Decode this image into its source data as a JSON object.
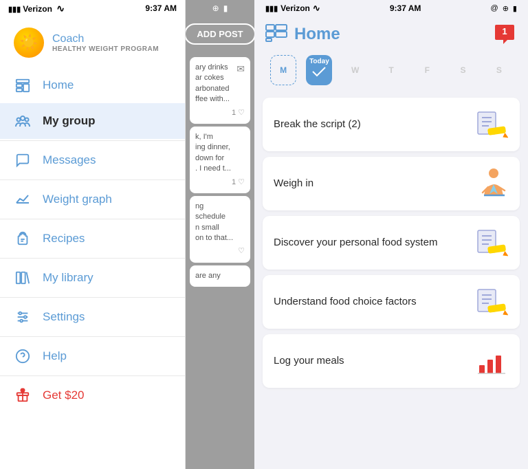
{
  "leftPanel": {
    "statusBar": {
      "carrier": "Verizon",
      "wifi": "wifi",
      "time": "9:37 AM"
    },
    "coach": {
      "label": "Coach",
      "subtitle": "HEALTHY WEIGHT PROGRAM"
    },
    "navItems": [
      {
        "id": "home",
        "label": "Home",
        "icon": "home-icon"
      },
      {
        "id": "my-group",
        "label": "My group",
        "icon": "group-icon",
        "active": true
      },
      {
        "id": "messages",
        "label": "Messages",
        "icon": "message-icon"
      },
      {
        "id": "weight-graph",
        "label": "Weight graph",
        "icon": "graph-icon"
      },
      {
        "id": "recipes",
        "label": "Recipes",
        "icon": "recipes-icon"
      },
      {
        "id": "my-library",
        "label": "My library",
        "icon": "library-icon"
      },
      {
        "id": "settings",
        "label": "Settings",
        "icon": "settings-icon"
      },
      {
        "id": "help",
        "label": "Help",
        "icon": "help-icon"
      },
      {
        "id": "get-20",
        "label": "Get $20",
        "icon": "gift-icon",
        "red": true
      }
    ]
  },
  "middlePanel": {
    "statusBar": {
      "btIcon": "⊕",
      "battery": "🔋"
    },
    "addPostBtn": "ADD POST",
    "feedItems": [
      {
        "text": "ary drinks\nar cokes\narbonated\nffee with...",
        "likes": "1",
        "hasEnvelope": true
      },
      {
        "text": "k, I'm\ning dinner,\ndown for\n. I need t...",
        "likes": "1",
        "hasEnvelope": false
      },
      {
        "text": "ng\nschedule\nn small\non to that...",
        "likes": "",
        "hasEnvelope": false,
        "hasHeart": true
      },
      {
        "text": "are any",
        "likes": "",
        "hasEnvelope": false
      }
    ]
  },
  "rightPanel": {
    "statusBar": {
      "carrier": "Verizon",
      "wifi": "wifi",
      "time": "9:37 AM",
      "icons": "@bluetooth battery"
    },
    "title": "Home",
    "notificationCount": "1",
    "days": [
      {
        "label": "M",
        "active": false,
        "outline": false,
        "empty": true
      },
      {
        "label": "Today",
        "active": true,
        "outline": false
      },
      {
        "label": "W",
        "active": false,
        "outline": false,
        "empty": true
      },
      {
        "label": "T",
        "active": false,
        "outline": false,
        "empty": true
      },
      {
        "label": "F",
        "active": false,
        "outline": false,
        "empty": true
      },
      {
        "label": "S",
        "active": false,
        "outline": false,
        "empty": true
      },
      {
        "label": "S",
        "active": false,
        "outline": false,
        "empty": true
      }
    ],
    "tasks": [
      {
        "id": 1,
        "text": "Break the script (2)",
        "iconType": "pencil"
      },
      {
        "id": 2,
        "text": "Weigh in",
        "iconType": "person"
      },
      {
        "id": 3,
        "text": "Discover your personal food system",
        "iconType": "pencil"
      },
      {
        "id": 4,
        "text": "Understand food choice factors",
        "iconType": "pencil"
      },
      {
        "id": 5,
        "text": "Log your meals",
        "iconType": "bar"
      }
    ]
  }
}
